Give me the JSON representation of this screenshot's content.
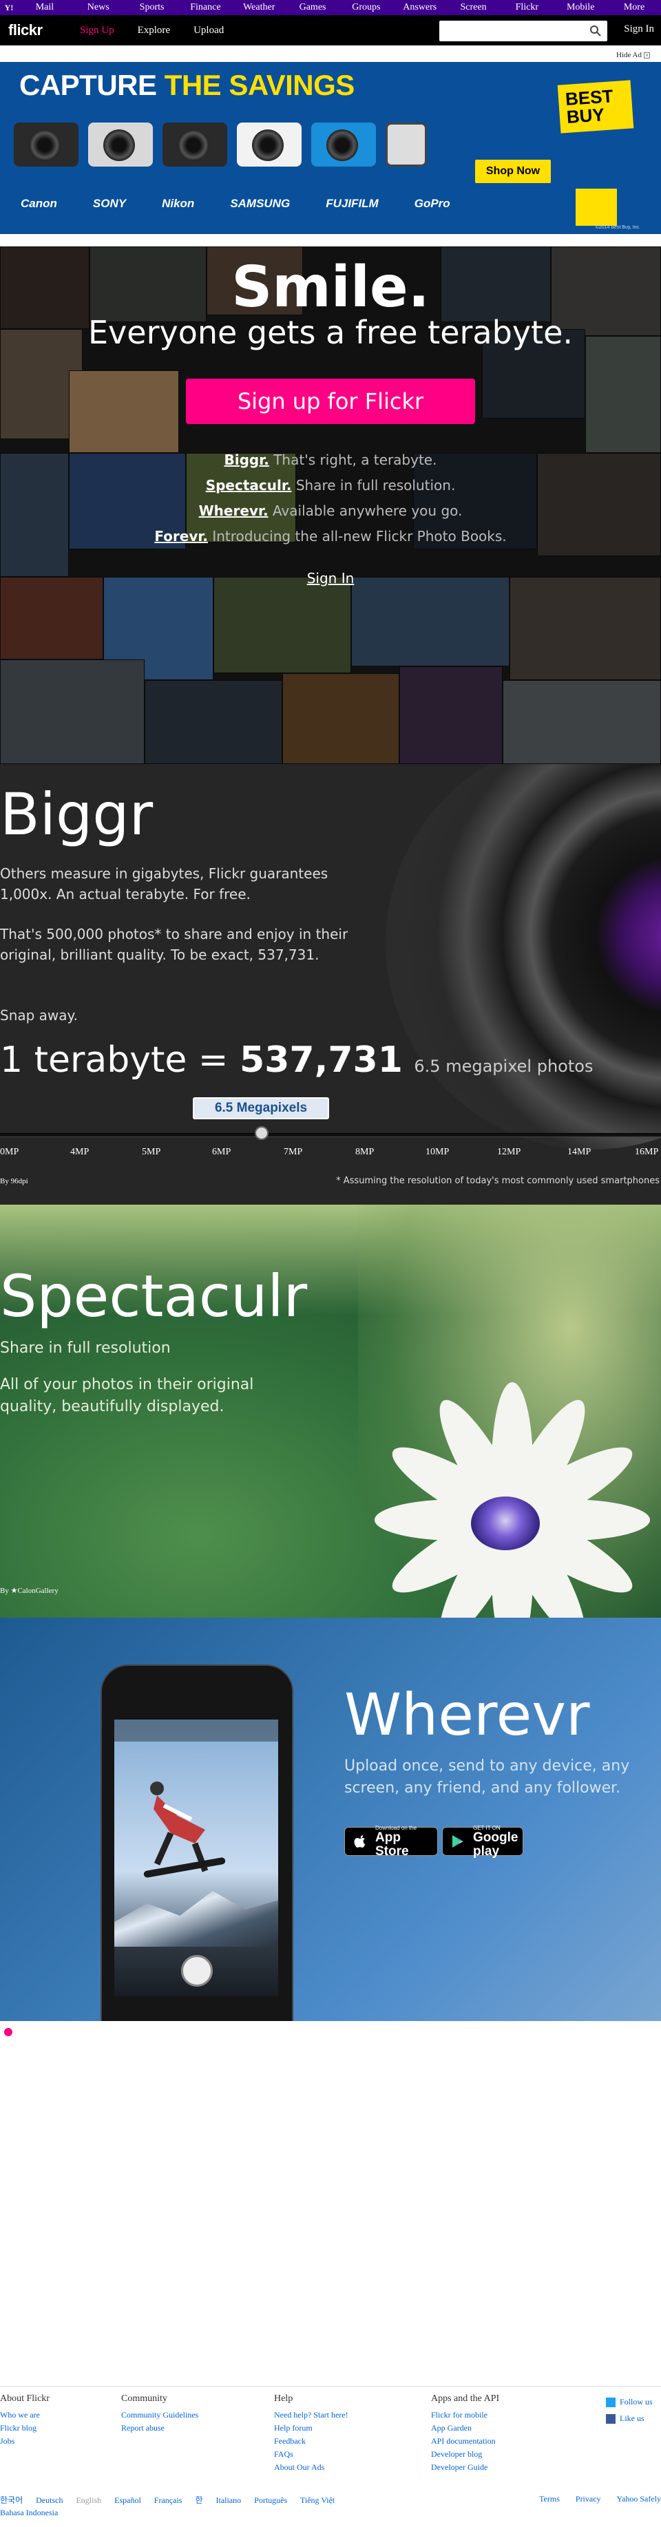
{
  "yahoo_bar": {
    "logo": "Y!",
    "links": [
      "Mail",
      "News",
      "Sports",
      "Finance",
      "Weather",
      "Games",
      "Groups",
      "Answers",
      "Screen",
      "Flickr",
      "Mobile",
      "More"
    ]
  },
  "nav": {
    "logo": "flickr",
    "signup": "Sign Up",
    "explore": "Explore",
    "upload": "Upload",
    "search_placeholder": "",
    "signin": "Sign In"
  },
  "ad": {
    "hide_label": "Hide Ad",
    "headline_white": "CAPTURE",
    "headline_yellow": "THE SAVINGS",
    "brands": [
      "Canon",
      "SONY",
      "Nikon",
      "SAMSUNG",
      "FUJIFILM",
      "GoPro"
    ],
    "bestbuy": "BEST BUY",
    "shop_now": "Shop Now",
    "fine_print": "©2014 Best Buy, Inc."
  },
  "hero": {
    "title": "Smile.",
    "tagline": "Everyone gets a free terabyte.",
    "cta": "Sign up for Flickr",
    "features": [
      {
        "name": "Biggr.",
        "text": "That's right, a terabyte."
      },
      {
        "name": "Spectaculr.",
        "text": "Share in full resolution."
      },
      {
        "name": "Wherevr.",
        "text": "Available anywhere you go."
      },
      {
        "name": "Forevr.",
        "text": "Introducing the all-new Flickr Photo Books."
      }
    ],
    "signin": "Sign In"
  },
  "biggr": {
    "title": "Biggr",
    "p1": "Others measure in gigabytes, Flickr guarantees 1,000x. An actual terabyte. For free.",
    "p2": "That's 500,000 photos* to share and enjoy in their original, brilliant quality. To be exact, 537,731.",
    "p3": "Snap away.",
    "eq_left": "1 terabyte =",
    "eq_number": "537,731",
    "eq_unit": "6.5 megapixel photos",
    "slider_label": "6.5 Megapixels",
    "slider_value_mp": 6.5,
    "ticks": [
      "0MP",
      "4MP",
      "5MP",
      "6MP",
      "7MP",
      "8MP",
      "10MP",
      "12MP",
      "14MP",
      "16MP"
    ],
    "credit": "By 96dpi",
    "footnote": "* Assuming the resolution of today's most commonly used smartphones"
  },
  "spectaculr": {
    "title": "Spectaculr",
    "sub": "Share in full resolution",
    "body": "All of your photos in their original quality, beautifully displayed.",
    "credit": "By ★CalonGallery"
  },
  "wherevr": {
    "title": "Wherevr",
    "body": "Upload once, send to any device, any screen, any friend, and any follower.",
    "appstore_small": "Download on the",
    "appstore_big": "App Store",
    "googleplay_small": "GET IT ON",
    "googleplay_big": "Google play"
  },
  "footer": {
    "columns": [
      {
        "heading": "About Flickr",
        "links": [
          "Who we are",
          "Flickr blog",
          "Jobs"
        ]
      },
      {
        "heading": "Community",
        "links": [
          "Community Guidelines",
          "Report abuse"
        ]
      },
      {
        "heading": "Help",
        "links": [
          "Need help? Start here!",
          "Help forum",
          "Feedback",
          "FAQs",
          "About Our Ads"
        ]
      },
      {
        "heading": "Apps and the API",
        "links": [
          "Flickr for mobile",
          "App Garden",
          "API documentation",
          "Developer blog",
          "Developer Guide"
        ]
      }
    ],
    "social": [
      "Follow us",
      "Like us"
    ],
    "languages": [
      "한국어",
      "Deutsch",
      "English",
      "Español",
      "Français",
      "한",
      "Italiano",
      "Português",
      "Tiếng Việt",
      "Bahasa Indonesia"
    ],
    "current_language": "English",
    "bottom_links": [
      "Terms",
      "Privacy",
      "Yahoo Safely"
    ]
  },
  "colors": {
    "yahoo_purple": "#400090",
    "flickr_pink": "#ff0084",
    "link_blue": "#0063dc"
  }
}
